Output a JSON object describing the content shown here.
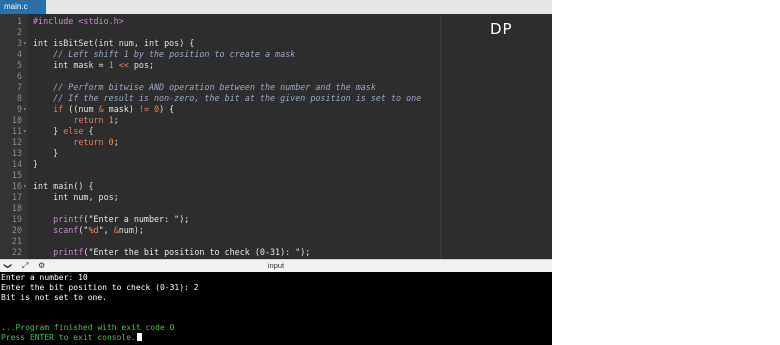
{
  "tab": {
    "label": "main.c"
  },
  "annotation": "DP",
  "code_lines": [
    {
      "n": "1",
      "fold": "",
      "parts": [
        {
          "t": "#include <stdio.h>",
          "c": "pp"
        }
      ]
    },
    {
      "n": "2",
      "fold": "",
      "parts": []
    },
    {
      "n": "3",
      "fold": "▾",
      "parts": [
        {
          "t": "int isBitSet(int num, int pos) {",
          "c": "k"
        }
      ]
    },
    {
      "n": "4",
      "fold": "",
      "parts": [
        {
          "t": "    // Left shift 1 by the position to create a mask",
          "c": "cm"
        }
      ]
    },
    {
      "n": "5",
      "fold": "",
      "parts": [
        {
          "t": "    int mask = ",
          "c": "k"
        },
        {
          "t": "1",
          "c": "num"
        },
        {
          "t": " << ",
          "c": "op"
        },
        {
          "t": "pos;",
          "c": "k"
        }
      ]
    },
    {
      "n": "6",
      "fold": "",
      "parts": []
    },
    {
      "n": "7",
      "fold": "",
      "parts": [
        {
          "t": "    // Perform bitwise AND operation between the number and the mask",
          "c": "cm"
        }
      ]
    },
    {
      "n": "8",
      "fold": "",
      "parts": [
        {
          "t": "    // If the result is non-zero, the bit at the given position is set to one",
          "c": "cm"
        }
      ]
    },
    {
      "n": "9",
      "fold": "▾",
      "parts": [
        {
          "t": "    if ",
          "c": "op"
        },
        {
          "t": "((num ",
          "c": "k"
        },
        {
          "t": "&",
          "c": "op"
        },
        {
          "t": " mask) ",
          "c": "k"
        },
        {
          "t": "!=",
          "c": "op"
        },
        {
          "t": " ",
          "c": "k"
        },
        {
          "t": "0",
          "c": "num"
        },
        {
          "t": ") {",
          "c": "k"
        }
      ]
    },
    {
      "n": "10",
      "fold": "",
      "parts": [
        {
          "t": "        return ",
          "c": "op"
        },
        {
          "t": "1",
          "c": "num"
        },
        {
          "t": ";",
          "c": "k"
        }
      ]
    },
    {
      "n": "11",
      "fold": "▾",
      "parts": [
        {
          "t": "    } ",
          "c": "k"
        },
        {
          "t": "else",
          "c": "op"
        },
        {
          "t": " {",
          "c": "k"
        }
      ]
    },
    {
      "n": "12",
      "fold": "",
      "parts": [
        {
          "t": "        return ",
          "c": "op"
        },
        {
          "t": "0",
          "c": "num"
        },
        {
          "t": ";",
          "c": "k"
        }
      ]
    },
    {
      "n": "13",
      "fold": "",
      "parts": [
        {
          "t": "    }",
          "c": "k"
        }
      ]
    },
    {
      "n": "14",
      "fold": "",
      "parts": [
        {
          "t": "}",
          "c": "k"
        }
      ]
    },
    {
      "n": "15",
      "fold": "",
      "parts": []
    },
    {
      "n": "16",
      "fold": "▾",
      "parts": [
        {
          "t": "int main() {",
          "c": "k"
        }
      ]
    },
    {
      "n": "17",
      "fold": "",
      "parts": [
        {
          "t": "    int num, pos;",
          "c": "k"
        }
      ]
    },
    {
      "n": "18",
      "fold": "",
      "parts": []
    },
    {
      "n": "19",
      "fold": "",
      "parts": [
        {
          "t": "    printf",
          "c": "fn"
        },
        {
          "t": "(\"Enter a number: \");",
          "c": "str"
        }
      ]
    },
    {
      "n": "20",
      "fold": "",
      "parts": [
        {
          "t": "    scanf",
          "c": "fn"
        },
        {
          "t": "(\"",
          "c": "str"
        },
        {
          "t": "%d",
          "c": "fmt"
        },
        {
          "t": "\", ",
          "c": "str"
        },
        {
          "t": "&",
          "c": "amp"
        },
        {
          "t": "num);",
          "c": "k"
        }
      ]
    },
    {
      "n": "21",
      "fold": "",
      "parts": []
    },
    {
      "n": "22",
      "fold": "",
      "parts": [
        {
          "t": "    printf",
          "c": "fn"
        },
        {
          "t": "(\"Enter the bit position to check (0-31): \");",
          "c": "str"
        }
      ]
    }
  ],
  "toolbar": {
    "collapse_icon": "❯",
    "expand_icon": "⤢",
    "settings_icon": "⚙",
    "input_label": "input"
  },
  "console": {
    "lines": [
      {
        "text": "Enter a number: 10",
        "green": false
      },
      {
        "text": "Enter the bit position to check (0-31): 2",
        "green": false
      },
      {
        "text": "Bit is not set to one.",
        "green": false
      },
      {
        "text": "",
        "green": false
      },
      {
        "text": "",
        "green": false
      },
      {
        "text": "...Program finished with exit code 0",
        "green": true
      },
      {
        "text": "Press ENTER to exit console.",
        "green": true
      }
    ]
  }
}
